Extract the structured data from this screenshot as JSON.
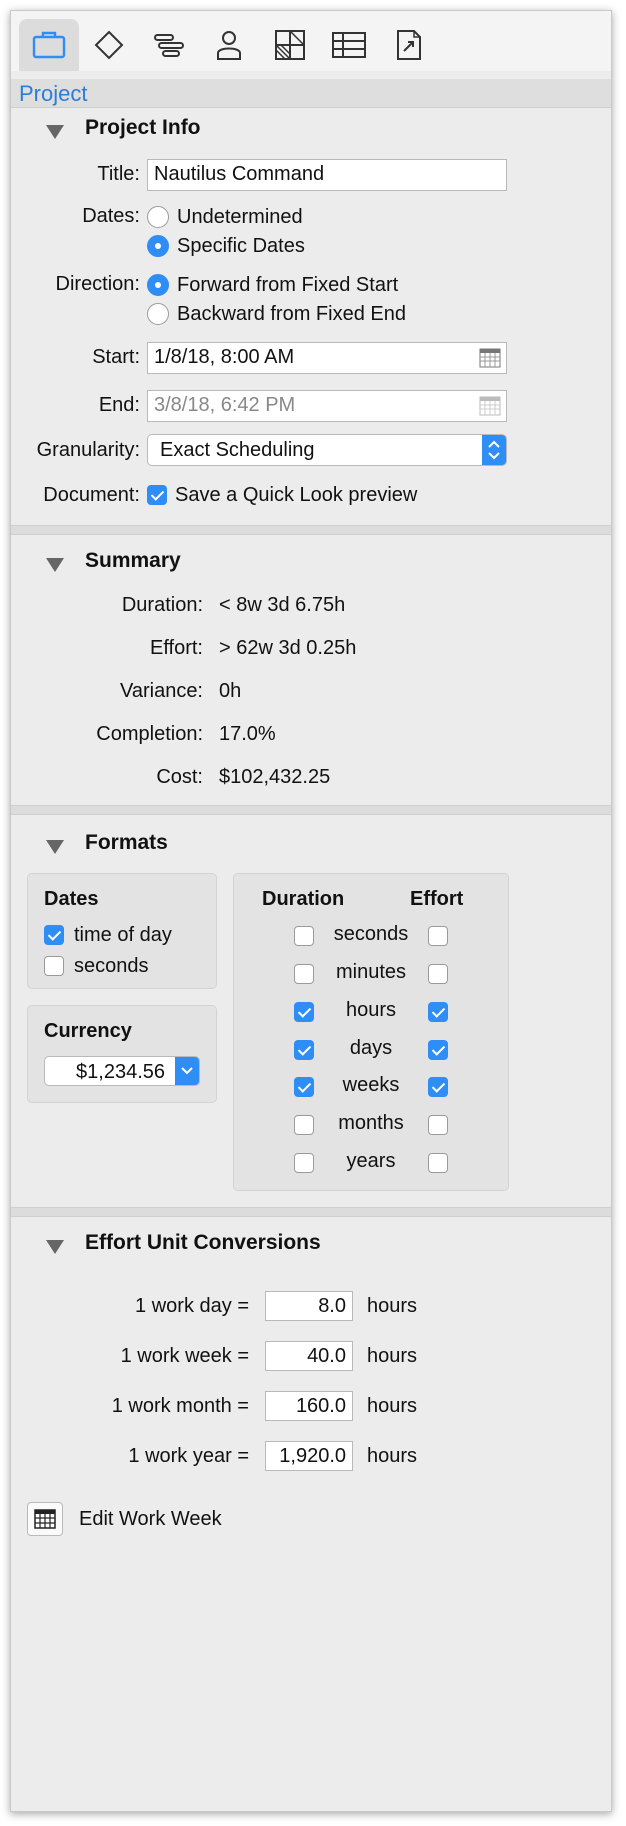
{
  "tab_label": "Project",
  "toolbar": {
    "tabs": [
      {
        "name": "project-tab",
        "icon": "briefcase-icon"
      },
      {
        "name": "task-tab",
        "icon": "diamond-icon"
      },
      {
        "name": "style-tab",
        "icon": "gantt-bars-icon"
      },
      {
        "name": "resource-tab",
        "icon": "person-icon"
      },
      {
        "name": "grid-tab",
        "icon": "checker-grid-icon"
      },
      {
        "name": "table-tab",
        "icon": "table-icon"
      },
      {
        "name": "export-tab",
        "icon": "export-doc-icon"
      }
    ]
  },
  "project_info": {
    "title": "Project Info",
    "title_label": "Title:",
    "title_value": "Nautilus Command",
    "dates_label": "Dates:",
    "dates_opt1": "Undetermined",
    "dates_opt2": "Specific Dates",
    "direction_label": "Direction:",
    "direction_opt1": "Forward from Fixed Start",
    "direction_opt2": "Backward from Fixed End",
    "start_label": "Start:",
    "start_value": "1/8/18, 8:00 AM",
    "end_label": "End:",
    "end_value": "3/8/18, 6:42 PM",
    "granularity_label": "Granularity:",
    "granularity_value": "Exact Scheduling",
    "document_label": "Document:",
    "document_check": "Save a Quick Look preview"
  },
  "summary": {
    "title": "Summary",
    "rows": [
      {
        "label": "Duration:",
        "value": "< 8w 3d 6.75h"
      },
      {
        "label": "Effort:",
        "value": "> 62w 3d 0.25h"
      },
      {
        "label": "Variance:",
        "value": "0h"
      },
      {
        "label": "Completion:",
        "value": "17.0%"
      },
      {
        "label": "Cost:",
        "value": "$102,432.25"
      }
    ]
  },
  "formats": {
    "title": "Formats",
    "dates_title": "Dates",
    "dates_opt1": "time of day",
    "dates_opt2": "seconds",
    "currency_title": "Currency",
    "currency_value": "$1,234.56",
    "duration_title": "Duration",
    "effort_title": "Effort",
    "units": [
      {
        "unit": "seconds",
        "duration": false,
        "effort": false
      },
      {
        "unit": "minutes",
        "duration": false,
        "effort": false
      },
      {
        "unit": "hours",
        "duration": true,
        "effort": true
      },
      {
        "unit": "days",
        "duration": true,
        "effort": true
      },
      {
        "unit": "weeks",
        "duration": true,
        "effort": true
      },
      {
        "unit": "months",
        "duration": false,
        "effort": false
      },
      {
        "unit": "years",
        "duration": false,
        "effort": false
      }
    ]
  },
  "conversions": {
    "title": "Effort Unit Conversions",
    "rows": [
      {
        "label": "1 work day =",
        "value": "8.0",
        "unit": "hours"
      },
      {
        "label": "1 work week =",
        "value": "40.0",
        "unit": "hours"
      },
      {
        "label": "1 work month =",
        "value": "160.0",
        "unit": "hours"
      },
      {
        "label": "1 work year =",
        "value": "1,920.0",
        "unit": "hours"
      }
    ]
  },
  "footer": {
    "edit_work_week": "Edit Work Week"
  },
  "colors": {
    "accent": "#2f8df6",
    "tab_label": "#2b7ddb"
  }
}
